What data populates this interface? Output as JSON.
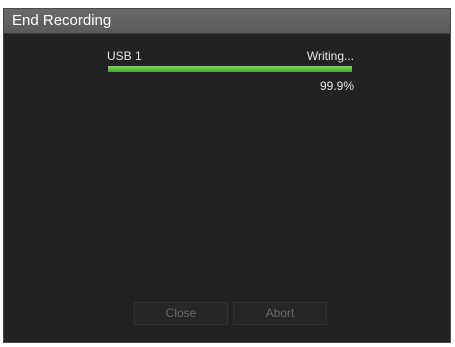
{
  "dialog": {
    "title": "End Recording"
  },
  "progress": {
    "device": "USB 1",
    "status": "Writing...",
    "percent_text": "99.9%",
    "fraction": 0.999,
    "fill_color": "#4caf38"
  },
  "buttons": {
    "close_label": "Close",
    "abort_label": "Abort",
    "enabled": false
  }
}
